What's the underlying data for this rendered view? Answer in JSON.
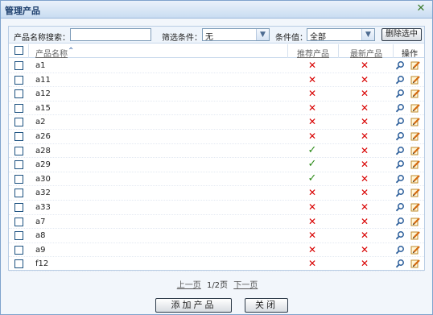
{
  "dialog": {
    "title": "管理产品",
    "close_icon": "close-icon"
  },
  "toolbar": {
    "search_label": "产品名称搜索：",
    "search_value": "",
    "filter_label": "筛选条件：",
    "filter_selected": "无",
    "condition_label": "条件值：",
    "condition_selected": "全部",
    "delete_selected_label": "删除选中"
  },
  "table": {
    "columns": {
      "name": "产品名称",
      "recommended": "推荐产品",
      "newest": "最新产品",
      "actions": "操作"
    },
    "sort_icon": "sort-ascending-icon",
    "rows": [
      {
        "name": "a1",
        "recommended": "no",
        "newest": "no"
      },
      {
        "name": "a11",
        "recommended": "no",
        "newest": "no"
      },
      {
        "name": "a12",
        "recommended": "no",
        "newest": "no"
      },
      {
        "name": "a15",
        "recommended": "no",
        "newest": "no"
      },
      {
        "name": "a2",
        "recommended": "no",
        "newest": "no"
      },
      {
        "name": "a26",
        "recommended": "no",
        "newest": "no"
      },
      {
        "name": "a28",
        "recommended": "yes",
        "newest": "no"
      },
      {
        "name": "a29",
        "recommended": "yes",
        "newest": "no"
      },
      {
        "name": "a30",
        "recommended": "yes",
        "newest": "no"
      },
      {
        "name": "a32",
        "recommended": "no",
        "newest": "no"
      },
      {
        "name": "a33",
        "recommended": "no",
        "newest": "no"
      },
      {
        "name": "a7",
        "recommended": "no",
        "newest": "no"
      },
      {
        "name": "a8",
        "recommended": "no",
        "newest": "no"
      },
      {
        "name": "a9",
        "recommended": "no",
        "newest": "no"
      },
      {
        "name": "f12",
        "recommended": "no",
        "newest": "no"
      }
    ],
    "icons": {
      "yes": "checkmark-icon",
      "no": "cross-icon",
      "view": "magnifier-icon",
      "edit": "pencil-icon"
    }
  },
  "pager": {
    "prev_label": "上一页",
    "page_info": "1/2页",
    "next_label": "下一页"
  },
  "footer": {
    "add_label": "添加产品",
    "close_label": "关闭"
  },
  "colors": {
    "yes": "#2b8a17",
    "no": "#d80000",
    "border": "#7fa3cc"
  }
}
